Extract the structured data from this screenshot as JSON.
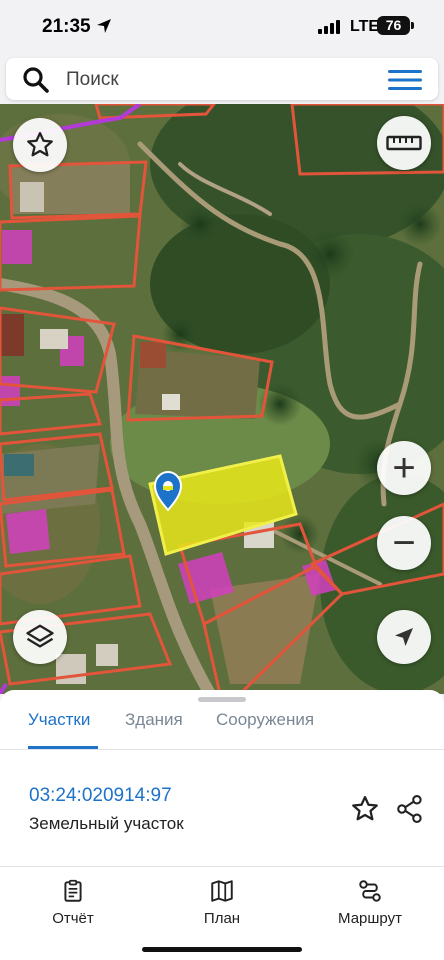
{
  "status": {
    "time": "21:35",
    "network": "LTE",
    "battery": "76"
  },
  "search": {
    "placeholder": "Поиск"
  },
  "map_controls": {
    "favorite": "star-icon",
    "ruler": "ruler-icon",
    "zoom_in": "+",
    "zoom_out": "−",
    "layers": "layers-icon",
    "locate": "navigation-arrow-icon"
  },
  "sheet": {
    "tabs": [
      {
        "label": "Участки",
        "active": true
      },
      {
        "label": "Здания",
        "active": false
      },
      {
        "label": "Сооружения",
        "active": false
      }
    ],
    "parcel": {
      "number": "03:24:020914:97",
      "type": "Земельный участок"
    }
  },
  "tabbar": {
    "items": [
      {
        "label": "Отчёт",
        "icon": "clipboard-icon"
      },
      {
        "label": "План",
        "icon": "map-icon"
      },
      {
        "label": "Маршрут",
        "icon": "route-icon"
      }
    ]
  },
  "colors": {
    "accent": "#1d72c9",
    "parcel_border": "#e2553a",
    "selected_parcel": "#e8e61a",
    "buildings": "#d23fc0"
  }
}
